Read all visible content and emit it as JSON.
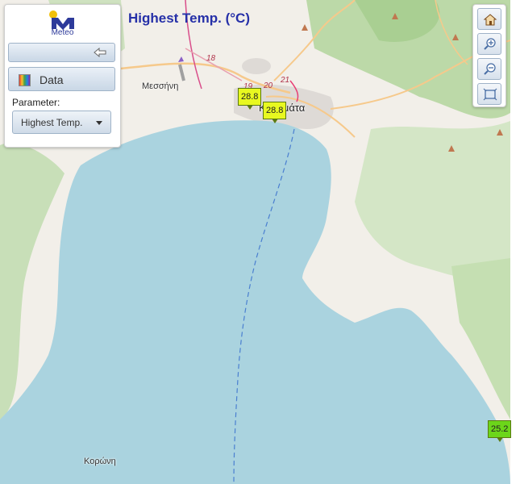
{
  "title": "Highest Temp. (°C)",
  "logo": {
    "text": "Meteo"
  },
  "panel": {
    "data_label": "Data",
    "parameter_label": "Parameter:",
    "parameter_value": "Highest Temp."
  },
  "toolbar": {
    "home_icon": "home-icon",
    "zoom_in_icon": "zoom-in-icon",
    "zoom_out_icon": "zoom-out-icon",
    "extent_icon": "full-extent-icon"
  },
  "map": {
    "places": [
      {
        "id": "messini",
        "label": "Μεσσήνη"
      },
      {
        "id": "kalamata",
        "label": "Καλαμάτα"
      },
      {
        "id": "koroni",
        "label": "Κορώνη"
      }
    ],
    "roads": [
      "18",
      "19",
      "20",
      "21"
    ],
    "stations": [
      {
        "id": "station-1",
        "value": "28.8"
      },
      {
        "id": "station-2",
        "value": "28.8"
      },
      {
        "id": "station-3",
        "value": "25.2"
      }
    ]
  },
  "colors": {
    "sea": "#aad3df",
    "land": "#f2efe9",
    "forest": "#add19e",
    "title": "#2630a8",
    "marker_yellow": "#e8f820",
    "marker_green": "#6cd61a"
  }
}
